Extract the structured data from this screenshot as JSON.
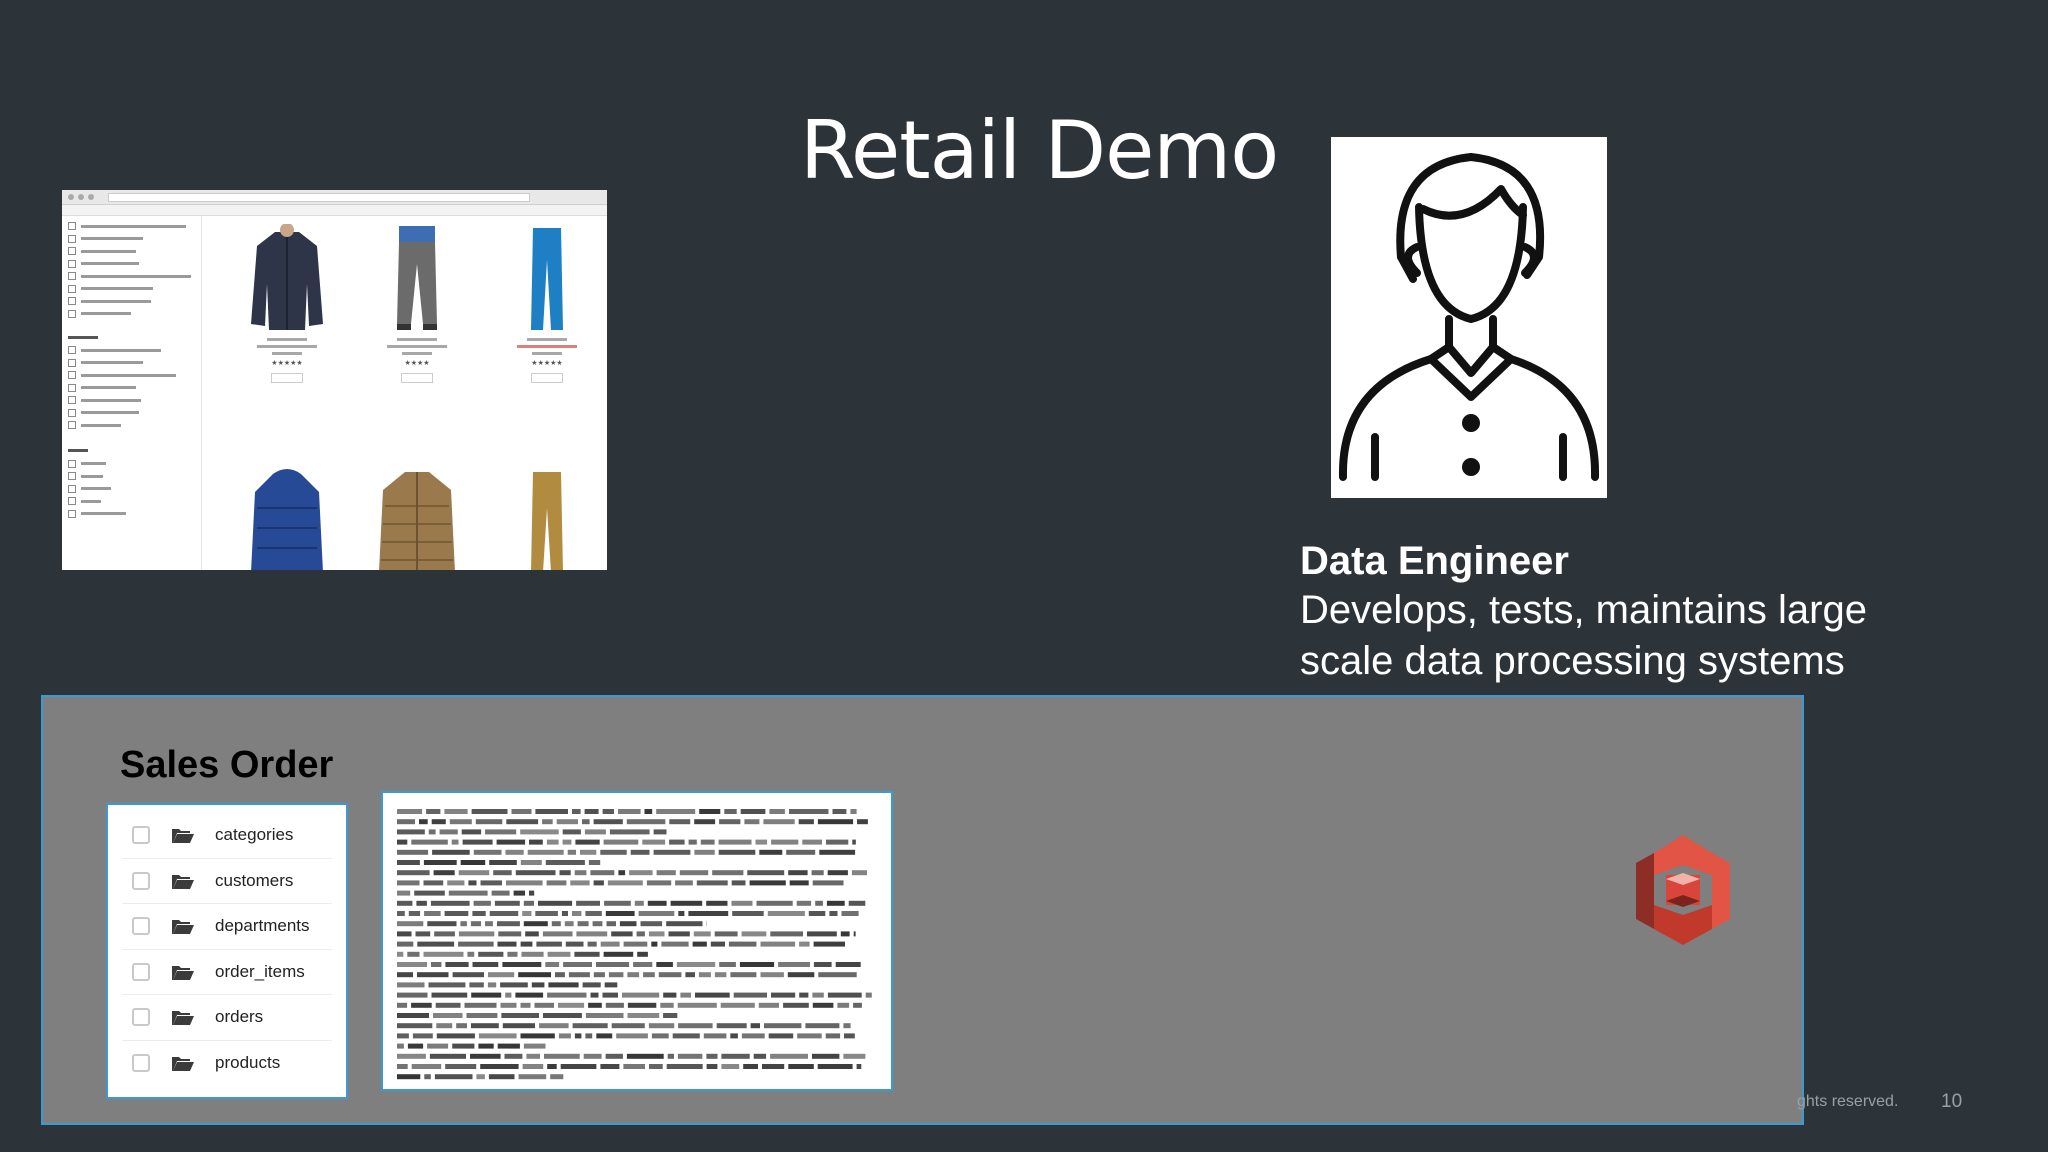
{
  "slide": {
    "title": "Retail Demo",
    "page_number": "10",
    "footer_copyright": "ghts reserved."
  },
  "persona": {
    "icon": "person-icon",
    "name": "Data Engineer",
    "description": "Develops, tests, maintains large scale data processing systems"
  },
  "sales_order": {
    "title": "Sales Order",
    "tables": [
      {
        "name": "categories"
      },
      {
        "name": "customers"
      },
      {
        "name": "departments"
      },
      {
        "name": "order_items"
      },
      {
        "name": "orders"
      },
      {
        "name": "products"
      }
    ],
    "storage_icon": "amazon-s3-icon"
  },
  "colors": {
    "background": "#2d3439",
    "panel": "#7f7f7f",
    "panel_border": "#3c9ad3",
    "s3_red": "#d9453a"
  }
}
